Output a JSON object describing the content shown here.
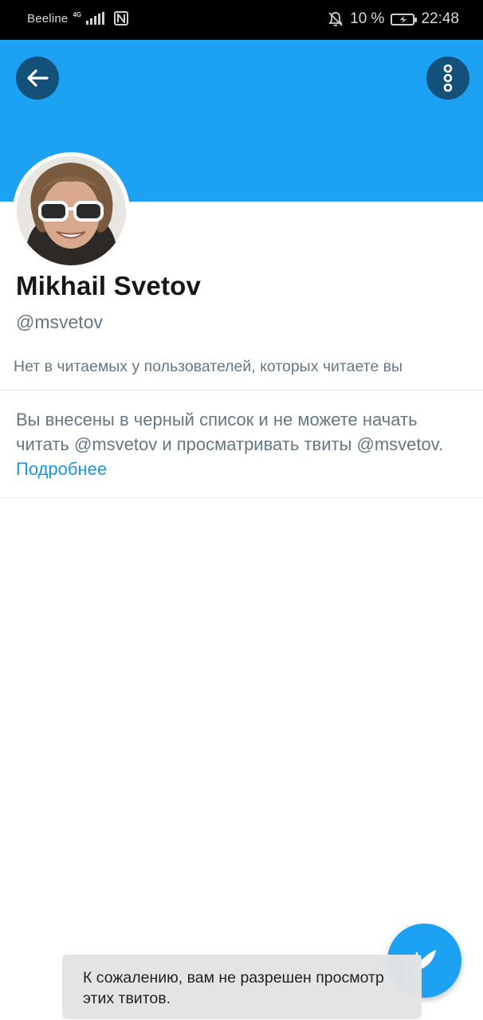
{
  "status_bar": {
    "carrier": "Beeline",
    "network": "4G",
    "battery_percent": "10 %",
    "time": "22:48",
    "icons": [
      "signal-icon",
      "nfc-icon",
      "mute-bell-icon",
      "battery-charging-icon"
    ]
  },
  "header": {
    "back_icon": "arrow-left-icon",
    "more_icon": "vertical-dots-icon",
    "banner_color": "#1da1f2",
    "button_color": "#14517a"
  },
  "profile": {
    "name": "Mikhail Svetov",
    "handle": "@msvetov",
    "followers_note": "Нет в читаемых у пользователей, которых читаете вы",
    "blocked_text": "Вы внесены в черный список и не можете начать читать @msvetov и просматривать твиты @msvetov.",
    "learn_more_label": "Подробнее"
  },
  "fab": {
    "icon": "compose-feather-icon",
    "color": "#1da1f2"
  },
  "toast": {
    "message": "К сожалению, вам не разрешен просмотр этих твитов."
  },
  "colors": {
    "accent": "#1da1f2",
    "link": "#1b95e0",
    "secondary_text": "#657786"
  }
}
